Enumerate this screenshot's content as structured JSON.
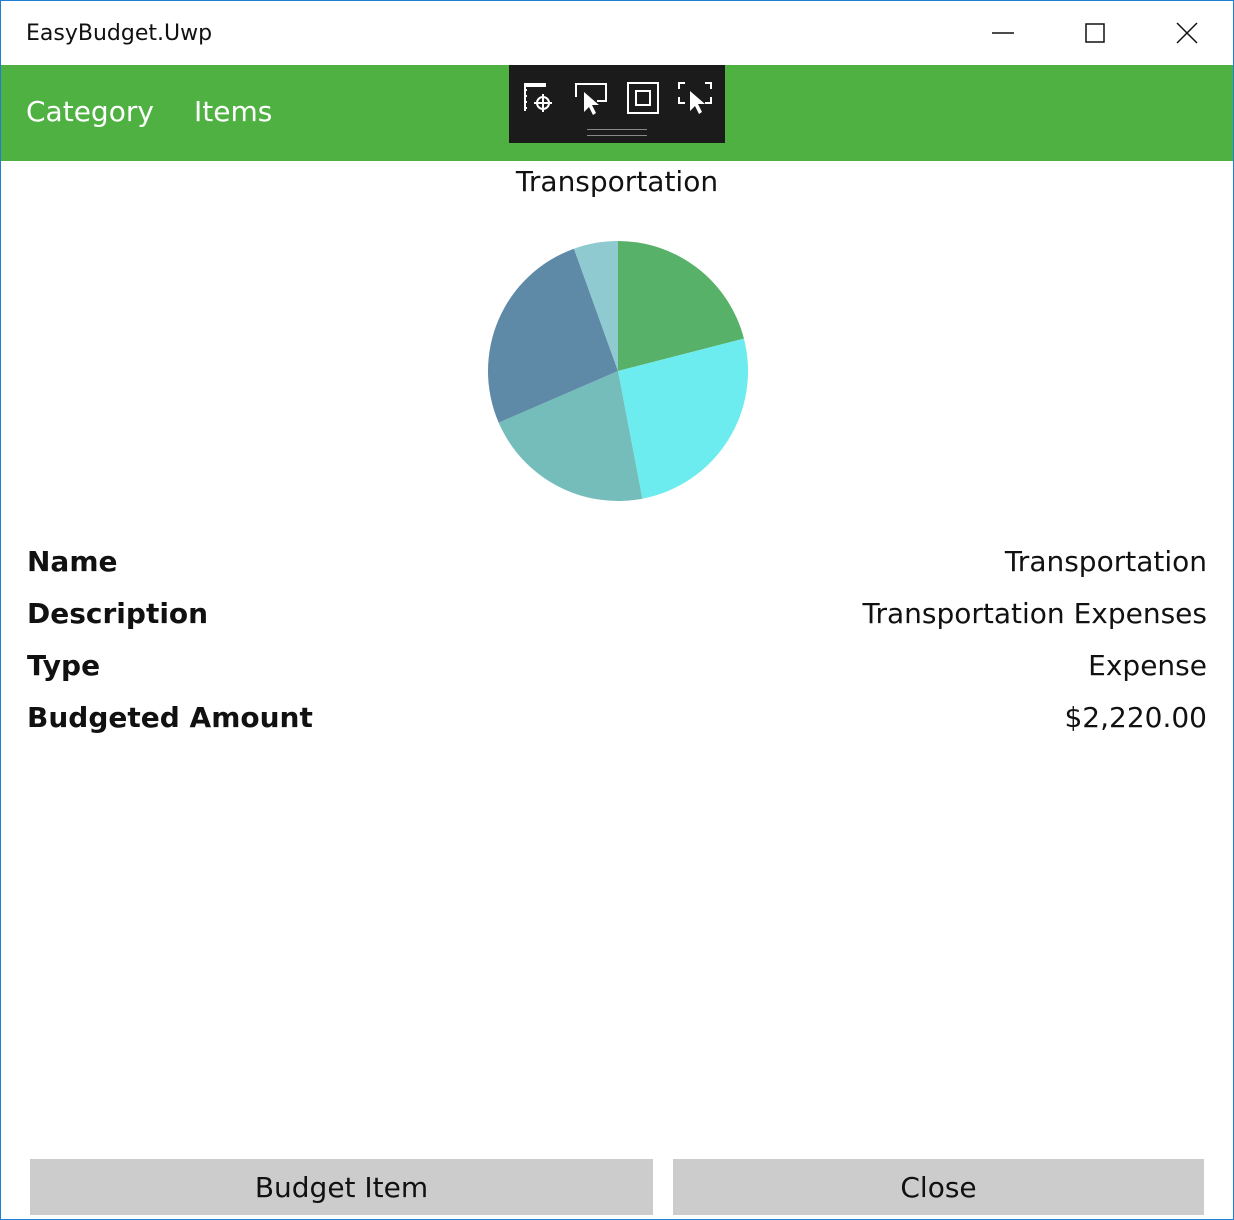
{
  "window": {
    "title": "EasyBudget.Uwp",
    "controls": {
      "minimize": "minimize-icon",
      "maximize": "maximize-icon",
      "close": "close-icon"
    }
  },
  "nav": {
    "items": [
      "Category",
      "Items"
    ],
    "color": "#4eb141"
  },
  "dev_toolbar": {
    "icons": [
      "live-visual-tree-icon",
      "select-element-icon",
      "display-layout-adorners-icon",
      "track-focus-icon"
    ]
  },
  "chart_data": {
    "type": "pie",
    "title": "Transportation",
    "slices": [
      {
        "value": 21.0,
        "color": "#57b168"
      },
      {
        "value": 26.0,
        "color": "#6cecee"
      },
      {
        "value": 21.5,
        "color": "#74bdbb"
      },
      {
        "value": 26.0,
        "color": "#5e8aa8"
      },
      {
        "value": 5.5,
        "color": "#8ecad0"
      }
    ],
    "legend": "none"
  },
  "details": [
    {
      "label": "Name",
      "value": "Transportation"
    },
    {
      "label": "Description",
      "value": "Transportation Expenses"
    },
    {
      "label": "Type",
      "value": "Expense"
    },
    {
      "label": "Budgeted Amount",
      "value": "$2,220.00"
    }
  ],
  "buttons": {
    "budget_item": "Budget Item",
    "close": "Close"
  }
}
